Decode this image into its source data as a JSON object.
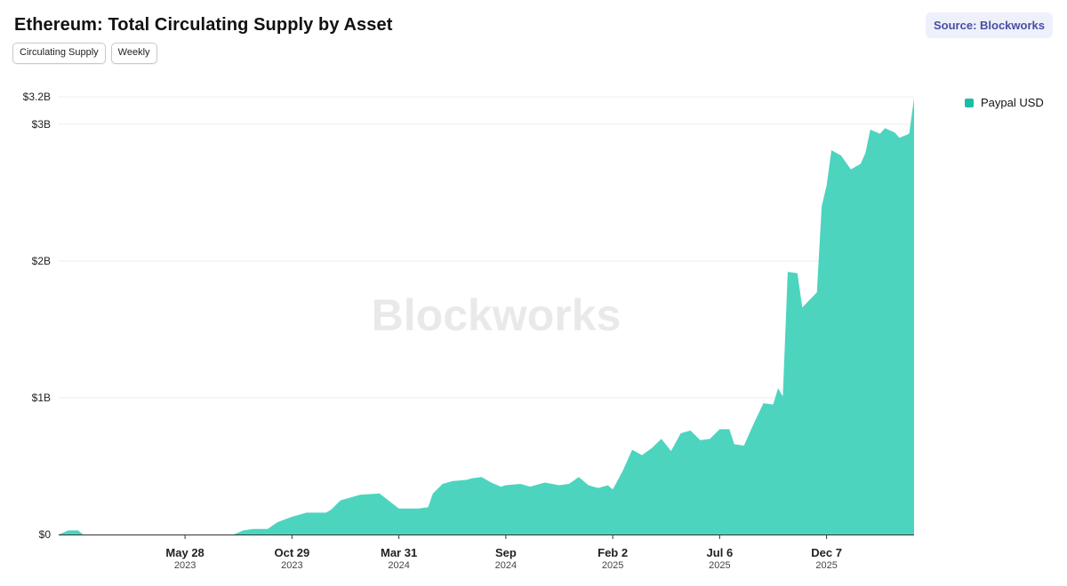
{
  "header": {
    "title": "Ethereum: Total Circulating Supply by Asset",
    "source": "Source: Blockworks"
  },
  "controls": {
    "metric_label": "Circulating Supply",
    "interval_label": "Weekly"
  },
  "watermark": "Blockworks",
  "colors": {
    "series": "#4dd4bf",
    "legend_swatch": "#19bfa2",
    "grid": "#eeeeee",
    "axis": "#333333"
  },
  "chart_data": {
    "type": "area",
    "title": "Ethereum: Total Circulating Supply by Asset",
    "xlabel": "",
    "ylabel": "",
    "ylim": [
      0,
      3.2
    ],
    "y_unit": "billion USD",
    "y_ticks": [
      {
        "value": 0,
        "label": "$0"
      },
      {
        "value": 1,
        "label": "$1B"
      },
      {
        "value": 2,
        "label": "$2B"
      },
      {
        "value": 3,
        "label": "$3B"
      },
      {
        "value": 3.2,
        "label": "$3.2B"
      }
    ],
    "x_ticks": [
      {
        "date": "2023-05-28",
        "label": "May 28",
        "sub": "2023"
      },
      {
        "date": "2023-10-29",
        "label": "Oct 29",
        "sub": "2023"
      },
      {
        "date": "2024-03-31",
        "label": "Mar 31",
        "sub": "2024"
      },
      {
        "date": "2024-09-01",
        "label": "Sep",
        "sub": "2024"
      },
      {
        "date": "2025-02-02",
        "label": "Feb 2",
        "sub": "2025"
      },
      {
        "date": "2025-07-06",
        "label": "Jul 6",
        "sub": "2025"
      },
      {
        "date": "2025-12-07",
        "label": "Dec 7",
        "sub": "2025"
      }
    ],
    "legend": "top-right",
    "grid": true,
    "series": [
      {
        "name": "Paypal USD",
        "points": [
          [
            "2022-11-27",
            0.0
          ],
          [
            "2022-12-11",
            0.03
          ],
          [
            "2022-12-25",
            0.03
          ],
          [
            "2023-01-01",
            0.0
          ],
          [
            "2023-05-28",
            0.0
          ],
          [
            "2023-08-06",
            0.0
          ],
          [
            "2023-08-20",
            0.03
          ],
          [
            "2023-09-03",
            0.04
          ],
          [
            "2023-09-24",
            0.04
          ],
          [
            "2023-10-08",
            0.09
          ],
          [
            "2023-10-29",
            0.13
          ],
          [
            "2023-11-19",
            0.16
          ],
          [
            "2023-12-17",
            0.16
          ],
          [
            "2023-12-24",
            0.18
          ],
          [
            "2024-01-07",
            0.25
          ],
          [
            "2024-01-21",
            0.27
          ],
          [
            "2024-02-04",
            0.29
          ],
          [
            "2024-03-03",
            0.3
          ],
          [
            "2024-03-31",
            0.19
          ],
          [
            "2024-04-28",
            0.19
          ],
          [
            "2024-05-12",
            0.2
          ],
          [
            "2024-05-19",
            0.3
          ],
          [
            "2024-06-02",
            0.37
          ],
          [
            "2024-06-16",
            0.39
          ],
          [
            "2024-07-07",
            0.4
          ],
          [
            "2024-07-14",
            0.41
          ],
          [
            "2024-07-28",
            0.42
          ],
          [
            "2024-08-11",
            0.38
          ],
          [
            "2024-08-25",
            0.35
          ],
          [
            "2024-09-01",
            0.36
          ],
          [
            "2024-09-22",
            0.37
          ],
          [
            "2024-10-06",
            0.35
          ],
          [
            "2024-10-27",
            0.38
          ],
          [
            "2024-11-17",
            0.36
          ],
          [
            "2024-12-01",
            0.37
          ],
          [
            "2024-12-15",
            0.42
          ],
          [
            "2024-12-29",
            0.36
          ],
          [
            "2025-01-12",
            0.34
          ],
          [
            "2025-01-26",
            0.36
          ],
          [
            "2025-02-02",
            0.33
          ],
          [
            "2025-02-16",
            0.46
          ],
          [
            "2025-03-02",
            0.62
          ],
          [
            "2025-03-16",
            0.58
          ],
          [
            "2025-03-30",
            0.63
          ],
          [
            "2025-04-13",
            0.7
          ],
          [
            "2025-04-27",
            0.61
          ],
          [
            "2025-05-11",
            0.74
          ],
          [
            "2025-05-25",
            0.76
          ],
          [
            "2025-06-08",
            0.69
          ],
          [
            "2025-06-22",
            0.7
          ],
          [
            "2025-07-06",
            0.77
          ],
          [
            "2025-07-20",
            0.77
          ],
          [
            "2025-07-27",
            0.66
          ],
          [
            "2025-08-10",
            0.65
          ],
          [
            "2025-08-24",
            0.81
          ],
          [
            "2025-09-07",
            0.96
          ],
          [
            "2025-09-21",
            0.95
          ],
          [
            "2025-09-28",
            1.07
          ],
          [
            "2025-10-05",
            1.01
          ],
          [
            "2025-10-12",
            1.92
          ],
          [
            "2025-10-26",
            1.91
          ],
          [
            "2025-11-02",
            1.66
          ],
          [
            "2025-11-23",
            1.77
          ],
          [
            "2025-11-30",
            2.4
          ],
          [
            "2025-12-07",
            2.55
          ],
          [
            "2025-12-14",
            2.81
          ],
          [
            "2025-12-28",
            2.77
          ],
          [
            "2026-01-11",
            2.67
          ],
          [
            "2026-01-25",
            2.71
          ],
          [
            "2026-02-01",
            2.79
          ],
          [
            "2026-02-08",
            2.96
          ],
          [
            "2026-02-22",
            2.93
          ],
          [
            "2026-03-01",
            2.97
          ],
          [
            "2026-03-15",
            2.94
          ],
          [
            "2026-03-22",
            2.9
          ],
          [
            "2026-04-05",
            2.93
          ],
          [
            "2026-04-12",
            3.19
          ]
        ]
      }
    ]
  }
}
